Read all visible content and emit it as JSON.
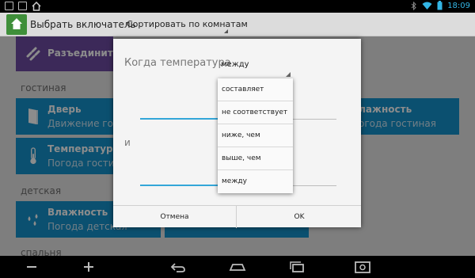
{
  "status_bar": {
    "time": "18:09",
    "icons": [
      "photo-icon",
      "shopping-bag-icon",
      "home-icon",
      "bluetooth-icon",
      "wifi-icon",
      "battery-icon"
    ]
  },
  "action_bar": {
    "title": "Выбрать включатель",
    "sort_label": "Сортировать по комнатам"
  },
  "content": {
    "tiles": [
      {
        "title": "Разъединить",
        "subtitle": "",
        "color": "#6d4ca3",
        "icon": "link-broken-icon"
      },
      {
        "title": "Дверь",
        "subtitle": "Движение гостиная",
        "color": "#1492cc",
        "icon": "door-icon"
      },
      {
        "title": "Влажность",
        "subtitle": "Погода гостиная",
        "color": "#1492cc",
        "icon": ""
      },
      {
        "title": "Температура",
        "subtitle": "Погода гостиная",
        "color": "#1492cc",
        "icon": "thermometer-icon"
      },
      {
        "title": "Влажность",
        "subtitle": "Погода детская",
        "color": "#1492cc",
        "icon": "droplets-icon"
      }
    ],
    "sections": [
      "гостиная",
      "детская",
      "спальня"
    ]
  },
  "dialog": {
    "condition_label": "Когда температура",
    "operator_value": "между",
    "and_label": "и",
    "cancel_label": "Отмена",
    "ok_label": "OK"
  },
  "dropdown": {
    "options": [
      "составляет",
      "не соответствует",
      "ниже, чем",
      "выше, чем",
      "между"
    ]
  },
  "colors": {
    "accent": "#33a6d8",
    "tile_blue": "#1492cc",
    "tile_purple": "#6d4ca3",
    "app_green": "#3f8f3a"
  },
  "nav_bar": {
    "buttons": [
      "volume-down-icon",
      "volume-up-icon",
      "back-icon",
      "home-icon",
      "recent-apps-icon",
      "screenshot-icon"
    ]
  }
}
